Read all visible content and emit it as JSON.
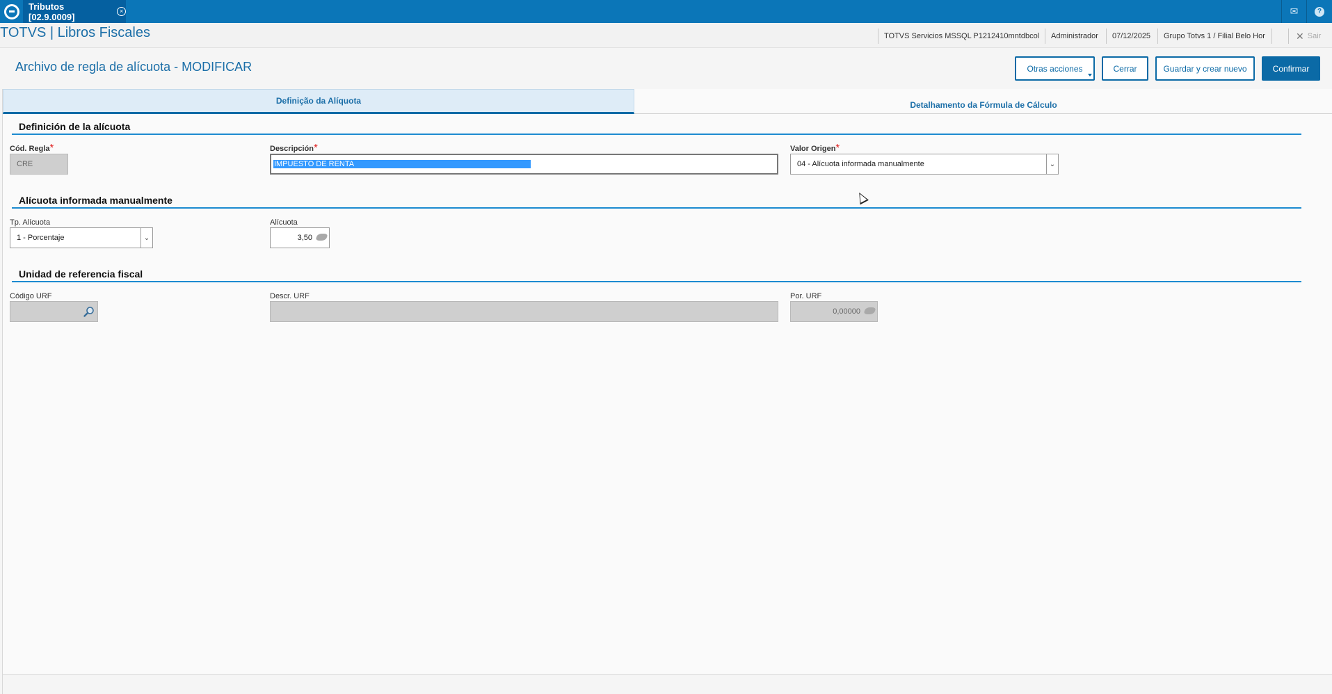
{
  "topbar": {
    "tab_label": "Tributos [02.9.0009]",
    "tab_close": "×",
    "mail_icon": "mail-icon",
    "help_label": "?"
  },
  "header": {
    "brand": "TOTVS | Libros Fiscales",
    "environment": "TOTVS Servicios MSSQL P1212410mntdbcol",
    "user": "Administrador",
    "date": "07/12/2025",
    "branch": "Grupo Totvs 1 / Filial Belo Hor",
    "logout_label": "Sair"
  },
  "page": {
    "title": "Archivo de regla de alícuota - MODIFICAR"
  },
  "actions": {
    "other": "Otras acciones",
    "close": "Cerrar",
    "save_new": "Guardar y crear nuevo",
    "confirm": "Confirmar"
  },
  "tabs": [
    {
      "label": "Definição da Alíquota",
      "active": true
    },
    {
      "label": "Detalhamento da Fórmula de Cálculo",
      "active": false
    }
  ],
  "sections": {
    "definition": "Definición de la alícuota",
    "manual": "Alícuota informada manualmente",
    "urf": "Unidad de referencia fiscal"
  },
  "fields": {
    "cod_regla": {
      "label": "Cód. Regla",
      "value": "CRE"
    },
    "descripcion": {
      "label": "Descripción",
      "value": "IMPUESTO DE RENTA"
    },
    "valor_origen": {
      "label": "Valor Origen",
      "value": "04 - Alícuota informada manualmente"
    },
    "tp_alicuota": {
      "label": "Tp. Alícuota",
      "value": "1 - Porcentaje"
    },
    "alicuota": {
      "label": "Alícuota",
      "value": "3,50"
    },
    "codigo_urf": {
      "label": "Código URF",
      "value": ""
    },
    "descr_urf": {
      "label": "Descr. URF",
      "value": ""
    },
    "por_urf": {
      "label": "Por. URF",
      "value": "0,00000"
    }
  },
  "required_mark": "*",
  "colors": {
    "topbar": "#0b76b8",
    "accent": "#0b6aa6",
    "title": "#1c6fa8",
    "required": "#e02020"
  }
}
